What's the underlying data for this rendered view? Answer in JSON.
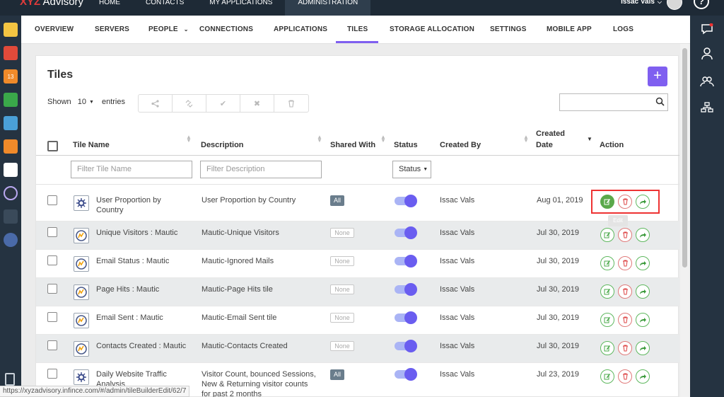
{
  "topbar": {
    "brand_first": "XYZ",
    "brand_rest": " Advisory",
    "nav": [
      "HOME",
      "CONTACTS",
      "MY APPLICATIONS",
      "ADMINISTRATION"
    ],
    "active_nav": "ADMINISTRATION",
    "user_name": "Issac Vals",
    "help_label": "?"
  },
  "subnav": {
    "items": [
      "OVERVIEW",
      "SERVERS",
      "PEOPLE",
      "CONNECTIONS",
      "APPLICATIONS",
      "TILES",
      "STORAGE ALLOCATION",
      "SETTINGS",
      "MOBILE APP",
      "LOGS"
    ],
    "active": "TILES"
  },
  "page": {
    "title": "Tiles",
    "add_label": "+",
    "shown_label": "Shown",
    "entries_value": "10",
    "entries_label": "entries",
    "search_value": ""
  },
  "table": {
    "headers": {
      "tile_name": "Tile Name",
      "description": "Description",
      "shared_with": "Shared With",
      "status": "Status",
      "created_by": "Created By",
      "created_date_1": "Created",
      "created_date_2": "Date",
      "action": "Action"
    },
    "filters": {
      "tile_name_placeholder": "Filter Tile Name",
      "description_placeholder": "Filter Description",
      "status_value": "Status"
    },
    "rows": [
      {
        "name_1": "User Proportion by",
        "name_2": "Country",
        "desc_1": "User Proportion by Country",
        "desc_2": "",
        "desc_3": "",
        "shared": "All",
        "created_by": "Issac Vals",
        "date": "Aug 01, 2019",
        "icon": "gear-tile-icon"
      },
      {
        "name_1": "Unique Visitors : Mautic",
        "name_2": "",
        "desc_1": "Mautic-Unique Visitors",
        "desc_2": "",
        "desc_3": "",
        "shared": "None",
        "created_by": "Issac Vals",
        "date": "Jul 30, 2019",
        "icon": "mautic-tile-icon"
      },
      {
        "name_1": "Email Status : Mautic",
        "name_2": "",
        "desc_1": "Mautic-Ignored Mails",
        "desc_2": "",
        "desc_3": "",
        "shared": "None",
        "created_by": "Issac Vals",
        "date": "Jul 30, 2019",
        "icon": "mautic-tile-icon"
      },
      {
        "name_1": "Page Hits : Mautic",
        "name_2": "",
        "desc_1": "Mautic-Page Hits tile",
        "desc_2": "",
        "desc_3": "",
        "shared": "None",
        "created_by": "Issac Vals",
        "date": "Jul 30, 2019",
        "icon": "mautic-tile-icon"
      },
      {
        "name_1": "Email Sent : Mautic",
        "name_2": "",
        "desc_1": "Mautic-Email Sent tile",
        "desc_2": "",
        "desc_3": "",
        "shared": "None",
        "created_by": "Issac Vals",
        "date": "Jul 30, 2019",
        "icon": "mautic-tile-icon"
      },
      {
        "name_1": "Contacts Created : Mautic",
        "name_2": "",
        "desc_1": "Mautic-Contacts Created",
        "desc_2": "",
        "desc_3": "",
        "shared": "None",
        "created_by": "Issac Vals",
        "date": "Jul 30, 2019",
        "icon": "mautic-tile-icon"
      },
      {
        "name_1": "Daily Website Traffic",
        "name_2": "Analysis",
        "desc_1": "Visitor Count, bounced Sessions,",
        "desc_2": "New & Returning visitor counts",
        "desc_3": "for past 2 months",
        "shared": "All",
        "created_by": "Issac Vals",
        "date": "Jul 23, 2019",
        "icon": "gear-tile-icon"
      }
    ],
    "tooltip": "Edit"
  },
  "statusbar": {
    "url": "https://xyzadvisory.infince.com/#/admin/tileBuilderEdit/62/7"
  },
  "colors": {
    "topbar": "#1e2a36",
    "accent": "#7f5ff0",
    "toggle_on": "#6a5df0",
    "edit_green": "#5aa84a",
    "delete_red": "#e07a7a",
    "highlight_red": "#ee3333"
  }
}
